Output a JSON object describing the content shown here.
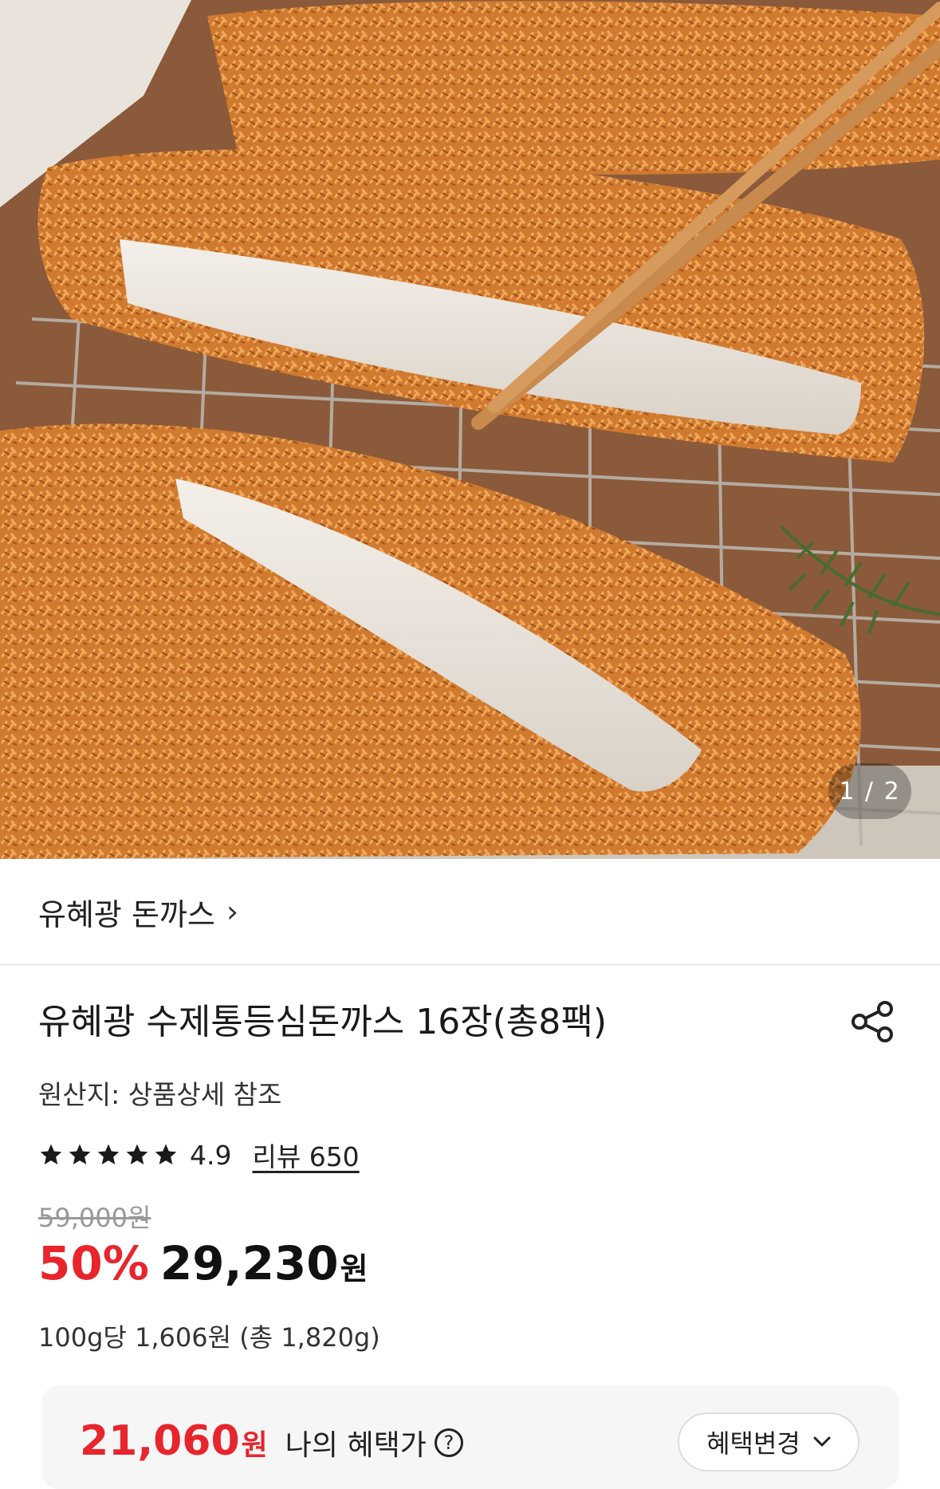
{
  "gallery": {
    "image_alt": "유혜광 수제통등심돈까스",
    "counter": "1 / 2"
  },
  "brand": {
    "name": "유혜광 돈까스",
    "chevron": "›"
  },
  "product": {
    "title": "유혜광 수제통등심돈까스 16장(총8팩)",
    "origin": "원산지: 상품상세 참조",
    "rating": "4.9",
    "stars": 5,
    "review_link": "리뷰 650",
    "original_price": "59,000원",
    "discount_percent": "50%",
    "sale_price": "29,230",
    "currency": "원",
    "unit_price": "100g당 1,606원 (총 1,820g)"
  },
  "benefit": {
    "price": "21,060",
    "currency": "원",
    "label": "나의 혜택가",
    "info_icon": "?",
    "change_button": "혜택변경"
  },
  "icons": {
    "share": "share-icon",
    "star": "star-icon",
    "chevron_down": "chevron-down-icon",
    "chevron_right": "chevron-right-icon"
  },
  "colors": {
    "accent": "#e8252d",
    "text": "#1a1a1a",
    "muted": "#999999",
    "panel": "#f6f6f6"
  }
}
